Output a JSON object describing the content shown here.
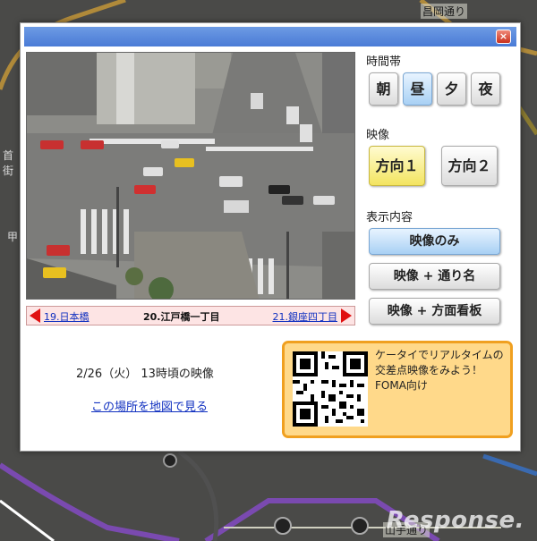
{
  "map": {
    "top_label": "昌岡通り",
    "bottom_label": "山手通り",
    "left_labels": [
      "首",
      "街"
    ],
    "left_label_mid": "甲",
    "watermark": "Response."
  },
  "dialog": {
    "close_glyph": "×",
    "location": {
      "prev": "19.日本橋",
      "current": "20.江戸橋一丁目",
      "next": "21.銀座四丁目"
    },
    "time_section_label": "時間帯",
    "time_buttons": [
      "朝",
      "昼",
      "夕",
      "夜"
    ],
    "time_selected": "昼",
    "video_section_label": "映像",
    "direction_buttons": [
      "方向１",
      "方向２"
    ],
    "direction_selected": "方向１",
    "display_section_label": "表示内容",
    "display_buttons": [
      "映像のみ",
      "映像 + 通り名",
      "映像 + 方面看板"
    ],
    "display_selected": "映像のみ",
    "datetime_text": "2/26（火） 13時頃の映像",
    "map_link": "この場所を地図で見る",
    "promo_lines": [
      "ケータイでリアルタイムの",
      "交差点映像をみよう！",
      "FOMA向け"
    ]
  },
  "colors": {
    "titlebar": "#4a7bd6",
    "promo_bg": "#ffd98a",
    "promo_border": "#f0a020",
    "arrow": "#e01010",
    "link": "#1030c0"
  }
}
